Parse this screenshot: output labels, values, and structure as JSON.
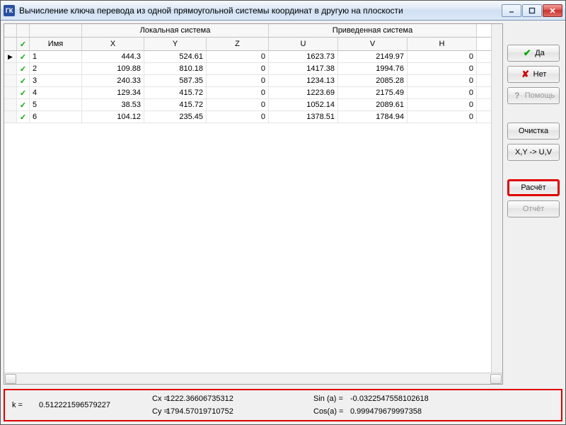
{
  "window": {
    "title": "Вычисление ключа перевода из одной прямоугольной системы координат в другую на плоскости",
    "app_icon_text": "ГК"
  },
  "grid": {
    "group_local": "Локальная система",
    "group_reduced": "Приведенная система",
    "headers": {
      "name": "Имя",
      "x": "X",
      "y": "Y",
      "z": "Z",
      "u": "U",
      "v": "V",
      "h": "H"
    },
    "check_glyph": "✓",
    "rows": [
      {
        "checked": true,
        "current": true,
        "name": "1",
        "x": "444.3",
        "y": "524.61",
        "z": "0",
        "u": "1623.73",
        "v": "2149.97",
        "h": "0"
      },
      {
        "checked": true,
        "current": false,
        "name": "2",
        "x": "109.88",
        "y": "810.18",
        "z": "0",
        "u": "1417.38",
        "v": "1994.76",
        "h": "0"
      },
      {
        "checked": true,
        "current": false,
        "name": "3",
        "x": "240.33",
        "y": "587.35",
        "z": "0",
        "u": "1234.13",
        "v": "2085.28",
        "h": "0"
      },
      {
        "checked": true,
        "current": false,
        "name": "4",
        "x": "129.34",
        "y": "415.72",
        "z": "0",
        "u": "1223.69",
        "v": "2175.49",
        "h": "0"
      },
      {
        "checked": true,
        "current": false,
        "name": "5",
        "x": "38.53",
        "y": "415.72",
        "z": "0",
        "u": "1052.14",
        "v": "2089.61",
        "h": "0"
      },
      {
        "checked": true,
        "current": false,
        "name": "6",
        "x": "104.12",
        "y": "235.45",
        "z": "0",
        "u": "1378.51",
        "v": "1784.94",
        "h": "0"
      }
    ]
  },
  "buttons": {
    "yes": "Да",
    "no": "Нет",
    "help": "Помощь",
    "clear": "Очистка",
    "xy_uv": "X,Y -> U,V",
    "calc": "Расчёт",
    "report": "Отчёт"
  },
  "results": {
    "cx_label": "Cx =",
    "cx": "1222.36606735312",
    "cy_label": "Cy =",
    "cy": "1794.57019710752",
    "k_label": "k =",
    "k": "0.512221596579227",
    "sin_label": "Sin (a) =",
    "sin": "-0.0322547558102618",
    "cos_label": "Cos(a) =",
    "cos": "0.999479679997358"
  }
}
